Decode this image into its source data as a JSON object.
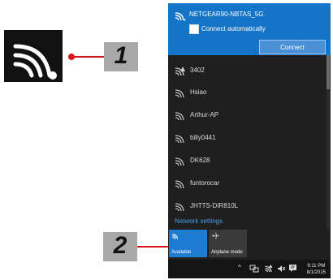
{
  "callouts": {
    "one": "1",
    "two": "2"
  },
  "flyout": {
    "active_network": "NETGEAR90-NBTAS_5G",
    "connect_automatically": "Connect automatically",
    "connect_button": "Connect",
    "networks": [
      "3402",
      "Hsiao",
      "Arthur-AP",
      "billy0441",
      "DK628",
      "funtorocar",
      "JHTTS-DIR810L"
    ],
    "network_settings": "Network settings",
    "tiles": {
      "available": "Available",
      "airplane": "Airplane mode"
    }
  },
  "taskbar": {
    "overflow": "^",
    "time": "9:11 PM",
    "date": "8/1/2015"
  },
  "colors": {
    "accent": "#1474c8",
    "callout_red": "#d8141a",
    "link": "#4d9be6"
  }
}
